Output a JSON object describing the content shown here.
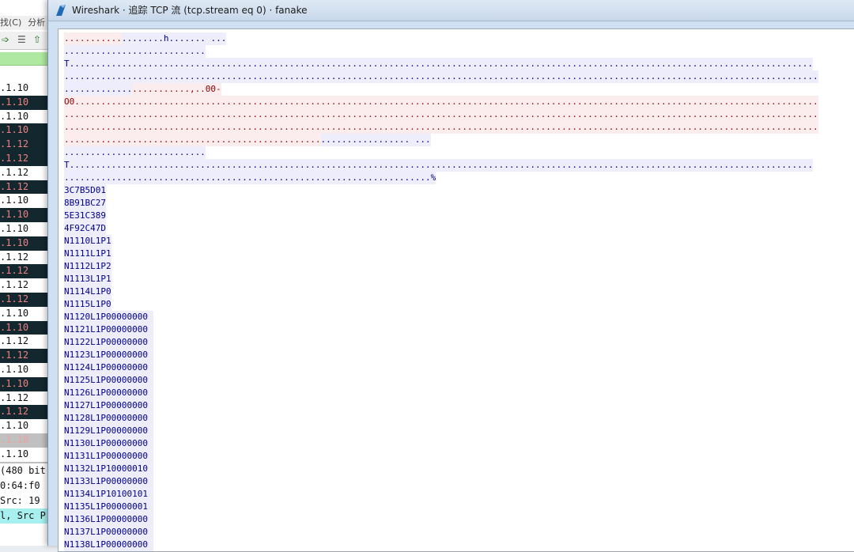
{
  "background_window": {
    "menu_items": [
      "找(C)",
      "分析"
    ],
    "toolbar_icons": [
      "forward-arrow-icon",
      "colorize-icon",
      "go-top-icon"
    ],
    "packet_rows": [
      {
        "text": ".1.10",
        "style": "light"
      },
      {
        "text": ".1.10",
        "style": "dark"
      },
      {
        "text": ".1.10",
        "style": "light"
      },
      {
        "text": ".1.10",
        "style": "dark"
      },
      {
        "text": ".1.12",
        "style": "dark"
      },
      {
        "text": ".1.12",
        "style": "dark"
      },
      {
        "text": ".1.12",
        "style": "light"
      },
      {
        "text": ".1.12",
        "style": "dark"
      },
      {
        "text": ".1.10",
        "style": "light"
      },
      {
        "text": ".1.10",
        "style": "dark"
      },
      {
        "text": ".1.10",
        "style": "light"
      },
      {
        "text": ".1.10",
        "style": "dark"
      },
      {
        "text": ".1.12",
        "style": "light"
      },
      {
        "text": ".1.12",
        "style": "dark"
      },
      {
        "text": ".1.12",
        "style": "light"
      },
      {
        "text": ".1.12",
        "style": "dark"
      },
      {
        "text": ".1.10",
        "style": "light"
      },
      {
        "text": ".1.10",
        "style": "dark"
      },
      {
        "text": ".1.12",
        "style": "light"
      },
      {
        "text": ".1.12",
        "style": "dark"
      },
      {
        "text": ".1.10",
        "style": "light"
      },
      {
        "text": ".1.10",
        "style": "dark"
      },
      {
        "text": ".1.12",
        "style": "light"
      },
      {
        "text": ".1.12",
        "style": "dark"
      },
      {
        "text": ".1.10",
        "style": "light"
      },
      {
        "text": ".1.10",
        "style": "sel"
      },
      {
        "text": ".1.10",
        "style": "light"
      }
    ],
    "detail_rows": [
      {
        "text": "(480 bit",
        "hl": false
      },
      {
        "text": "0:64:f0",
        "hl": false
      },
      {
        "text": " Src: 19",
        "hl": false
      },
      {
        "text": "l, Src P",
        "hl": true
      }
    ]
  },
  "dialog": {
    "title": "Wireshark · 追踪 TCP 流 (tcp.stream eq 0) · fanake",
    "colors": {
      "client_bg": "#fbeded",
      "client_fg": "#8b0000",
      "server_bg": "#ededfb",
      "server_fg": "#00008b"
    },
    "stream_lines": [
      [
        {
          "dir": "c",
          "text": "..........."
        },
        {
          "dir": "s",
          "text": "........h....... ..."
        }
      ],
      [
        {
          "dir": "s",
          "text": "..........................."
        }
      ],
      [
        {
          "dir": "s",
          "text": "T.............................................................................................................................................."
        }
      ],
      [
        {
          "dir": "s",
          "text": "................................................................................................................................................"
        }
      ],
      [
        {
          "dir": "s",
          "text": "............."
        },
        {
          "dir": "c",
          "text": "...........,..00-"
        }
      ],
      [
        {
          "dir": "c",
          "text": "O0.............................................................................................................................................."
        }
      ],
      [
        {
          "dir": "c",
          "text": "................................................................................................................................................"
        }
      ],
      [
        {
          "dir": "c",
          "text": "................................................................................................................................................"
        }
      ],
      [
        {
          "dir": "c",
          "text": "................................................."
        },
        {
          "dir": "s",
          "text": "................. ..."
        }
      ],
      [
        {
          "dir": "s",
          "text": "..........................."
        }
      ],
      [
        {
          "dir": "s",
          "text": "T.............................................................................................................................................."
        }
      ],
      [
        {
          "dir": "s",
          "text": "......................................................................%"
        }
      ],
      [
        {
          "dir": "s",
          "text": "3C7B5D01"
        }
      ],
      [
        {
          "dir": "s",
          "text": "8B91BC27"
        }
      ],
      [
        {
          "dir": "s",
          "text": "5E31C389"
        }
      ],
      [
        {
          "dir": "s",
          "text": "4F92C47D"
        }
      ],
      [
        {
          "dir": "s",
          "text": "N1110L1P1"
        }
      ],
      [
        {
          "dir": "s",
          "text": "N1111L1P1"
        }
      ],
      [
        {
          "dir": "s",
          "text": "N1112L1P2"
        }
      ],
      [
        {
          "dir": "s",
          "text": "N1113L1P1"
        }
      ],
      [
        {
          "dir": "s",
          "text": "N1114L1P0"
        }
      ],
      [
        {
          "dir": "s",
          "text": "N1115L1P0"
        }
      ],
      [
        {
          "dir": "s",
          "text": "N1120L1P00000000 "
        }
      ],
      [
        {
          "dir": "s",
          "text": "N1121L1P00000000 "
        }
      ],
      [
        {
          "dir": "s",
          "text": "N1122L1P00000000 "
        }
      ],
      [
        {
          "dir": "s",
          "text": "N1123L1P00000000 "
        }
      ],
      [
        {
          "dir": "s",
          "text": "N1124L1P00000000 "
        }
      ],
      [
        {
          "dir": "s",
          "text": "N1125L1P00000000 "
        }
      ],
      [
        {
          "dir": "s",
          "text": "N1126L1P00000000 "
        }
      ],
      [
        {
          "dir": "s",
          "text": "N1127L1P00000000 "
        }
      ],
      [
        {
          "dir": "s",
          "text": "N1128L1P00000000 "
        }
      ],
      [
        {
          "dir": "s",
          "text": "N1129L1P00000000 "
        }
      ],
      [
        {
          "dir": "s",
          "text": "N1130L1P00000000 "
        }
      ],
      [
        {
          "dir": "s",
          "text": "N1131L1P00000000 "
        }
      ],
      [
        {
          "dir": "s",
          "text": "N1132L1P10000010 "
        }
      ],
      [
        {
          "dir": "s",
          "text": "N1133L1P00000000 "
        }
      ],
      [
        {
          "dir": "s",
          "text": "N1134L1P10100101 "
        }
      ],
      [
        {
          "dir": "s",
          "text": "N1135L1P00000001 "
        }
      ],
      [
        {
          "dir": "s",
          "text": "N1136L1P00000000 "
        }
      ],
      [
        {
          "dir": "s",
          "text": "N1137L1P00000000 "
        }
      ],
      [
        {
          "dir": "s",
          "text": "N1138L1P00000000 "
        }
      ]
    ]
  }
}
